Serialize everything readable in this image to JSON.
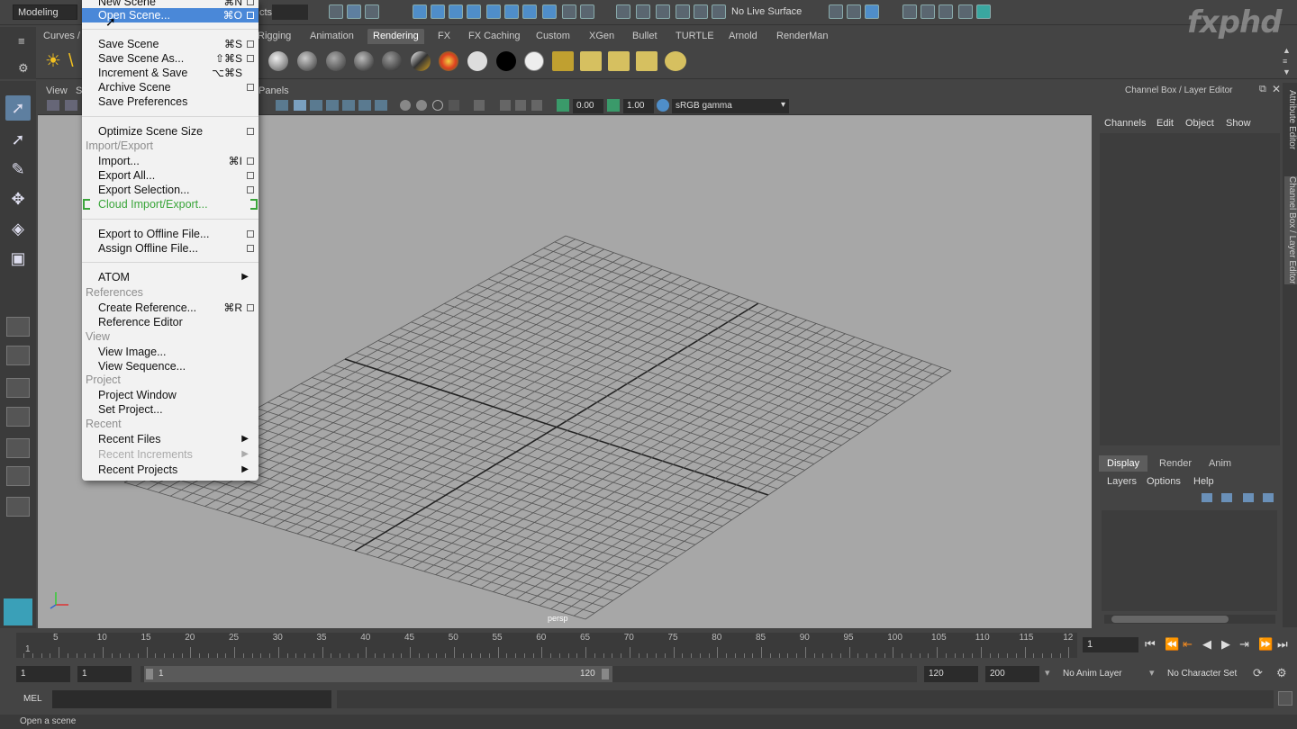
{
  "status_line": {
    "mode": "Modeling",
    "objects_fragment": "cts",
    "live_surface": "No Live Surface"
  },
  "logo": {
    "text": "fxphd"
  },
  "shelf_tabs": [
    "Curves /",
    "Rigging",
    "Animation",
    "Rendering",
    "FX",
    "FX Caching",
    "Custom",
    "XGen",
    "Bullet",
    "TURTLE",
    "Arnold",
    "RenderMan"
  ],
  "active_shelf_tab": "Rendering",
  "viewport": {
    "menu_view": "View",
    "menu_s": "S",
    "menu_panels": "Panels",
    "exposure": "0.00",
    "gamma": "1.00",
    "color_space": "sRGB gamma",
    "camera_label": "persp"
  },
  "file_menu": {
    "new_scene": "New Scene",
    "new_scene_sc": "⌘N",
    "open_scene": "Open Scene...",
    "open_scene_sc": "⌘O",
    "save_scene": "Save Scene",
    "save_scene_sc": "⌘S",
    "save_scene_as": "Save Scene As...",
    "save_scene_as_sc": "⇧⌘S",
    "increment_save": "Increment & Save",
    "increment_save_sc": "⌥⌘S",
    "archive_scene": "Archive Scene",
    "save_preferences": "Save Preferences",
    "optimize_scene_size": "Optimize Scene Size",
    "section_import_export": "Import/Export",
    "import": "Import...",
    "import_sc": "⌘I",
    "export_all": "Export All...",
    "export_selection": "Export Selection...",
    "cloud_import_export": "Cloud Import/Export...",
    "export_offline": "Export to Offline File...",
    "assign_offline": "Assign Offline File...",
    "atom": "ATOM",
    "section_references": "References",
    "create_reference": "Create Reference...",
    "create_reference_sc": "⌘R",
    "reference_editor": "Reference Editor",
    "section_view": "View",
    "view_image": "View Image...",
    "view_sequence": "View Sequence...",
    "section_project": "Project",
    "project_window": "Project Window",
    "set_project": "Set Project...",
    "section_recent": "Recent",
    "recent_files": "Recent Files",
    "recent_increments": "Recent Increments",
    "recent_projects": "Recent Projects"
  },
  "channel_box": {
    "title": "Channel Box / Layer Editor",
    "menus": [
      "Channels",
      "Edit",
      "Object",
      "Show"
    ],
    "layer_tabs": [
      "Display",
      "Render",
      "Anim"
    ],
    "active_layer_tab": "Display",
    "layer_menus": [
      "Layers",
      "Options",
      "Help"
    ],
    "side_tab_1": "Attribute Editor",
    "side_tab_2": "Channel Box / Layer Editor"
  },
  "time_slider": {
    "ticks": [
      "1",
      "5",
      "10",
      "15",
      "20",
      "25",
      "30",
      "35",
      "40",
      "45",
      "50",
      "55",
      "60",
      "65",
      "70",
      "75",
      "80",
      "85",
      "90",
      "95",
      "100",
      "105",
      "110",
      "115",
      "12"
    ],
    "current_frame": "1"
  },
  "range_slider": {
    "start": "1",
    "playback_start": "1",
    "range_start": "1",
    "range_end": "120",
    "playback_end": "120",
    "end": "200",
    "anim_layer": "No Anim Layer",
    "character_set": "No Character Set"
  },
  "command_line": {
    "lang": "MEL"
  },
  "help_line": {
    "text": "Open a scene"
  },
  "colors": {
    "accent": "#4a88d8",
    "cloud_green": "#3aa53a",
    "viewport_bg": "#a7a7a7"
  }
}
